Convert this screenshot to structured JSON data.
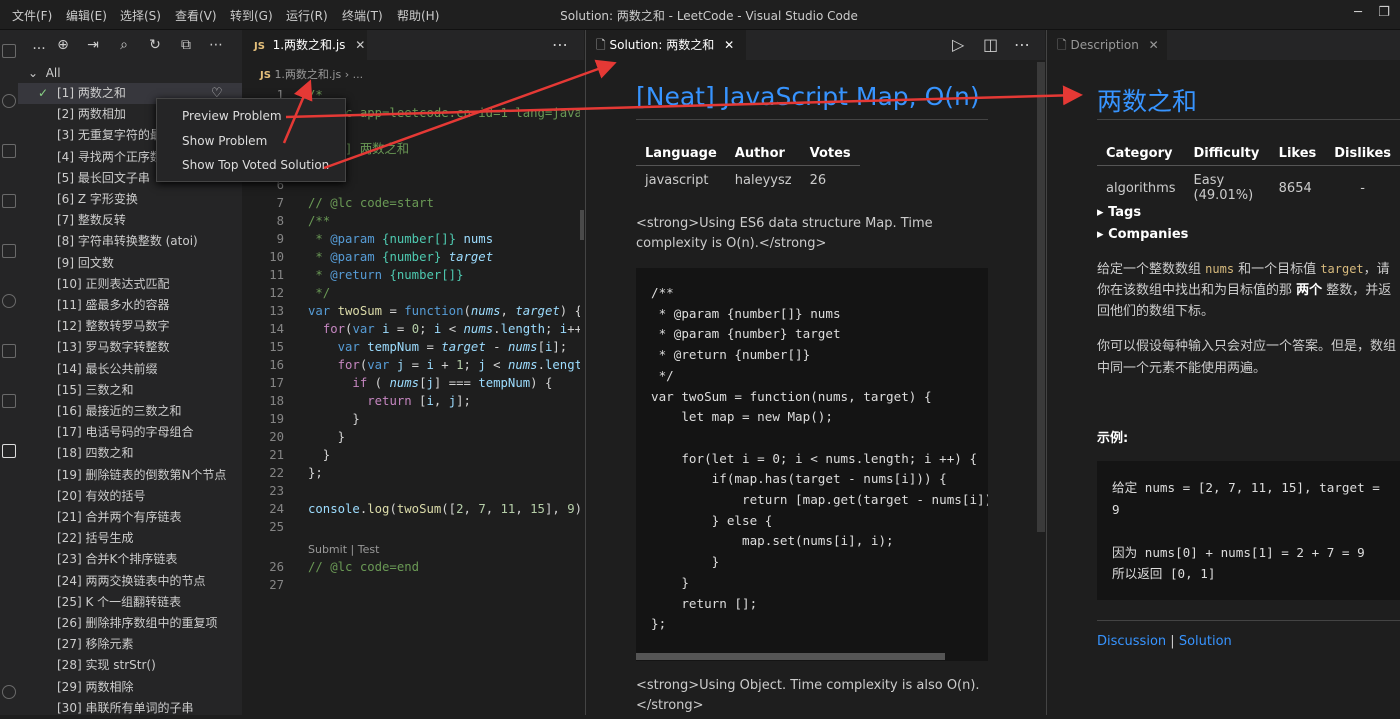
{
  "menubar": {
    "items": [
      "文件(F)",
      "编辑(E)",
      "选择(S)",
      "查看(V)",
      "转到(G)",
      "运行(R)",
      "终端(T)",
      "帮助(H)"
    ],
    "title": "Solution: 两数之和 - LeetCode - Visual Studio Code"
  },
  "sidebar": {
    "toolbar_more": "...",
    "all_label": "All",
    "problems": [
      "[1] 两数之和",
      "[2] 两数相加",
      "[3] 无重复字符的最",
      "[4] 寻找两个正序数",
      "[5] 最长回文子串",
      "[6] Z 字形变换",
      "[7] 整数反转",
      "[8] 字符串转换整数 (atoi)",
      "[9] 回文数",
      "[10] 正则表达式匹配",
      "[11] 盛最多水的容器",
      "[12] 整数转罗马数字",
      "[13] 罗马数字转整数",
      "[14] 最长公共前缀",
      "[15] 三数之和",
      "[16] 最接近的三数之和",
      "[17] 电话号码的字母组合",
      "[18] 四数之和",
      "[19] 删除链表的倒数第N个节点",
      "[20] 有效的括号",
      "[21] 合并两个有序链表",
      "[22] 括号生成",
      "[23] 合并K个排序链表",
      "[24] 两两交换链表中的节点",
      "[25] K 个一组翻转链表",
      "[26] 删除排序数组中的重复项",
      "[27] 移除元素",
      "[28] 实现 strStr()",
      "[29] 两数相除",
      "[30] 串联所有单词的子串"
    ]
  },
  "context_menu": {
    "items": [
      "Preview Problem",
      "Show Problem",
      "Show Top Voted Solution"
    ]
  },
  "editor": {
    "tab_badge": "JS",
    "tab_label": "1.两数之和.js",
    "crumb_file": "1.两数之和.js",
    "crumb_rest": "› ...",
    "codelens": "Submit | Test"
  },
  "solution": {
    "tab_label": "Solution: 两数之和",
    "title": "[Neat] JavaScript Map, O(n)",
    "headers": [
      "Language",
      "Author",
      "Votes"
    ],
    "language": "javascript",
    "author": "haleyysz",
    "votes": "26",
    "intro": "<strong>Using ES6 data structure Map. Time complexity is O(n).</strong>",
    "code": [
      "/**",
      " * @param {number[]} nums",
      " * @param {number} target",
      " * @return {number[]}",
      " */",
      "var twoSum = function(nums, target) {",
      "    let map = new Map();",
      "",
      "    for(let i = 0; i < nums.length; i ++) {",
      "        if(map.has(target - nums[i])) {",
      "            return [map.get(target - nums[i]), i];",
      "        } else {",
      "            map.set(nums[i], i);",
      "        }",
      "    }",
      "    return [];",
      "};"
    ],
    "outro": "<strong>Using Object. Time complexity is also O(n).</strong>"
  },
  "description": {
    "tab_label": "Description",
    "title": "两数之和",
    "headers": [
      "Category",
      "Difficulty",
      "Likes",
      "Dislikes"
    ],
    "category": "algorithms",
    "difficulty": "Easy (49.01%)",
    "likes": "8654",
    "dislikes": "-",
    "tags": "Tags",
    "companies": "Companies",
    "p1a": "给定一个整数数组 ",
    "p1_nums": "nums",
    "p1b": " 和一个目标值 ",
    "p1_target": "target",
    "p1c": "，请你在该数组中找出和为目标值的那 ",
    "p1_bold": "两个",
    "p1d": " 整数，并返回他们的数组下标。",
    "p2": "你可以假设每种输入只会对应一个答案。但是，数组中同一个元素不能使用两遍。",
    "example_label": "示例:",
    "ex1": "给定 nums = [2, 7, 11, 15], target =",
    "ex2": "9",
    "ex3": "因为 nums[0] + nums[1] = 2 + 7 = 9",
    "ex4": "所以返回 [0, 1]",
    "discussion": "Discussion",
    "sep": "|",
    "solution": "Solution"
  },
  "colors": {
    "accent": "#3794ff",
    "arrow": "#e53935",
    "check": "#89d185"
  }
}
